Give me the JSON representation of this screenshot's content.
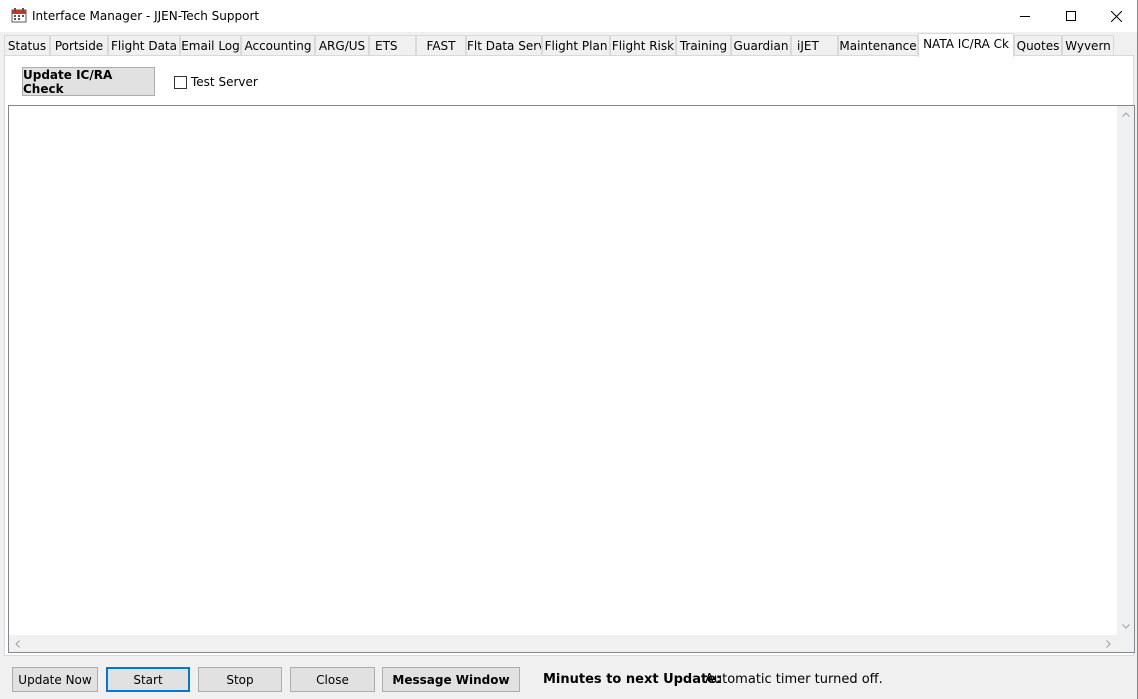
{
  "window": {
    "title": "Interface Manager - JJEN-Tech Support",
    "icon": "app-calendar-icon"
  },
  "tabs": [
    {
      "label": "Status"
    },
    {
      "label": "Portside"
    },
    {
      "label": "Flight Data"
    },
    {
      "label": "Email Log"
    },
    {
      "label": "Accounting"
    },
    {
      "label": "ARG/US"
    },
    {
      "label": "ETS"
    },
    {
      "label": "FAST"
    },
    {
      "label": "Flt Data Serv"
    },
    {
      "label": "Flight Plan"
    },
    {
      "label": "Flight Risk"
    },
    {
      "label": "Training"
    },
    {
      "label": "Guardian"
    },
    {
      "label": "iJET"
    },
    {
      "label": "Maintenance"
    },
    {
      "label": "NATA IC/RA Ck",
      "active": true
    },
    {
      "label": "Quotes"
    },
    {
      "label": "Wyvern"
    }
  ],
  "panel": {
    "update_button": "Update IC/RA Check",
    "test_server_label": "Test Server",
    "test_server_checked": false,
    "output_text": ""
  },
  "bottom": {
    "update_now": "Update Now",
    "start": "Start",
    "stop": "Stop",
    "close": "Close",
    "message_window": "Message Window",
    "minutes_label": "Minutes to next Update:",
    "timer_status": "Automatic timer turned off."
  },
  "colors": {
    "accent": "#0078d7",
    "window_bg": "#f0f0f0",
    "button_bg": "#e1e1e1"
  }
}
